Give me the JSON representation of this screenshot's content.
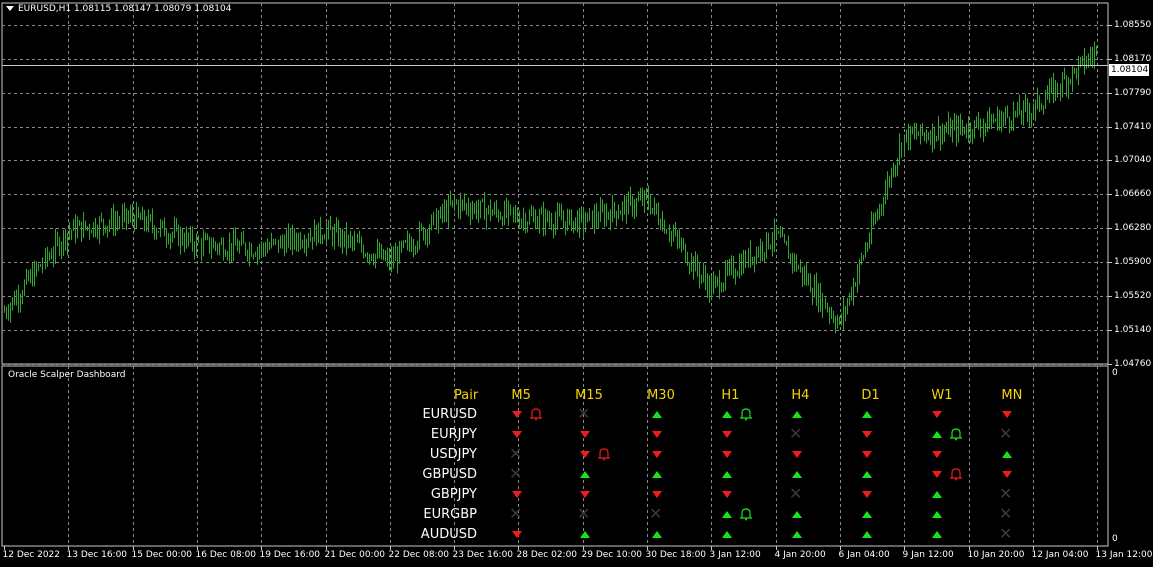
{
  "chart": {
    "header": "EURUSD,H1  1.08115 1.08147 1.08079 1.08104",
    "symbol": "EURUSD",
    "timeframe": "H1",
    "current_price": "1.08104",
    "price_axis": [
      "1.08550",
      "1.08170",
      "1.07790",
      "1.07410",
      "1.07040",
      "1.06660",
      "1.06280",
      "1.05900",
      "1.05520",
      "1.05140",
      "1.04760"
    ],
    "time_axis": [
      "12 Dec 2022",
      "13 Dec 16:00",
      "15 Dec 00:00",
      "16 Dec 08:00",
      "19 Dec 16:00",
      "21 Dec 00:00",
      "22 Dec 08:00",
      "23 Dec 16:00",
      "28 Dec 02:00",
      "29 Dec 10:00",
      "30 Dec 18:00",
      "3 Jan 12:00",
      "4 Jan 20:00",
      "6 Jan 04:00",
      "9 Jan 12:00",
      "10 Jan 20:00",
      "12 Jan 04:00",
      "13 Jan 12:00"
    ],
    "bar_color": "#2fa82f",
    "grid_color": "#8a8a8a"
  },
  "chart_data": {
    "type": "line",
    "title": "EURUSD,H1",
    "x": [
      "12 Dec 2022",
      "13 Dec 16:00",
      "15 Dec 00:00",
      "16 Dec 08:00",
      "19 Dec 16:00",
      "21 Dec 00:00",
      "22 Dec 08:00",
      "23 Dec 16:00",
      "28 Dec 02:00",
      "29 Dec 10:00",
      "30 Dec 18:00",
      "3 Jan 12:00",
      "4 Jan 20:00",
      "6 Jan 04:00",
      "9 Jan 12:00",
      "10 Jan 20:00",
      "12 Jan 04:00",
      "13 Jan 12:00"
    ],
    "series": [
      {
        "values": [
          1.0535,
          1.0625,
          1.064,
          1.061,
          1.0605,
          1.0625,
          1.059,
          1.0655,
          1.064,
          1.0635,
          1.066,
          1.056,
          1.062,
          1.052,
          1.073,
          1.074,
          1.076,
          1.0825
        ]
      }
    ],
    "ylim": [
      1.0476,
      1.0875
    ],
    "grid": true
  },
  "indicator": {
    "title": "Oracle Scalper Dashboard",
    "scale_top": "0",
    "scale_bottom": "0"
  },
  "dashboard": {
    "pair_header": "Pair",
    "timeframes": [
      "M5",
      "M15",
      "M30",
      "H1",
      "H4",
      "D1",
      "W1",
      "MN"
    ],
    "colors": {
      "header": "#f5d400",
      "up": "#19e619",
      "down": "#ee1c1c",
      "neutral": "#3a3a3a"
    },
    "rows": [
      {
        "pair": "EURUSD",
        "signals": [
          "down",
          "neutral",
          "up",
          "up",
          "up",
          "up",
          "down",
          "down"
        ],
        "alerts": [
          "M5:red",
          "H1:green"
        ]
      },
      {
        "pair": "EURJPY",
        "signals": [
          "down",
          "down",
          "down",
          "down",
          "neutral",
          "down",
          "up",
          "neutral"
        ],
        "alerts": [
          "W1:green"
        ]
      },
      {
        "pair": "USDJPY",
        "signals": [
          "neutral",
          "down",
          "down",
          "down",
          "down",
          "down",
          "down",
          "up"
        ],
        "alerts": [
          "M15:red"
        ]
      },
      {
        "pair": "GBPUSD",
        "signals": [
          "neutral",
          "up",
          "up",
          "up",
          "up",
          "up",
          "down",
          "down"
        ],
        "alerts": [
          "W1:red"
        ]
      },
      {
        "pair": "GBPJPY",
        "signals": [
          "down",
          "down",
          "down",
          "down",
          "neutral",
          "down",
          "up",
          "neutral"
        ],
        "alerts": []
      },
      {
        "pair": "EURGBP",
        "signals": [
          "neutral",
          "neutral",
          "neutral",
          "up",
          "up",
          "up",
          "up",
          "neutral"
        ],
        "alerts": [
          "H1:green"
        ]
      },
      {
        "pair": "AUDUSD",
        "signals": [
          "down",
          "up",
          "up",
          "up",
          "up",
          "up",
          "up",
          "neutral"
        ],
        "alerts": []
      }
    ]
  }
}
